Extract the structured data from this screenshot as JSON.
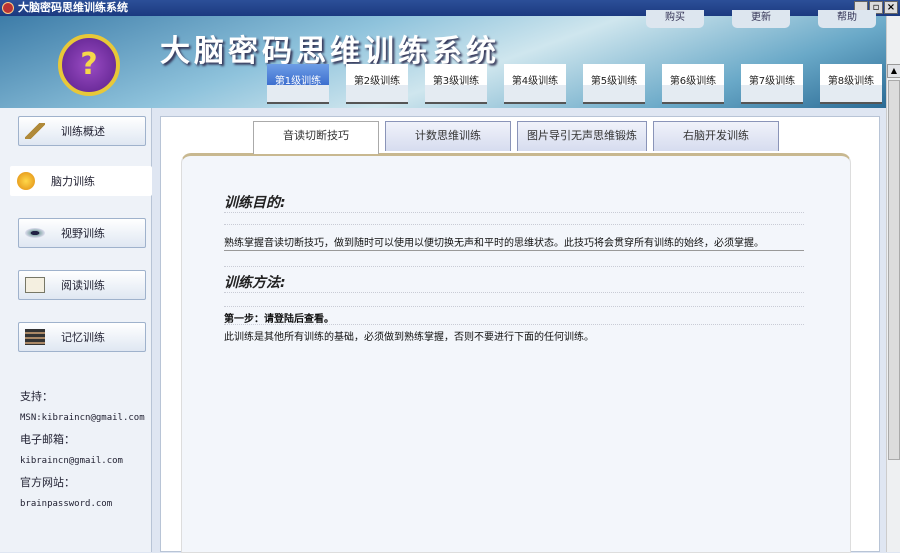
{
  "window": {
    "title": "大脑密码思维训练系统"
  },
  "header": {
    "app_title": "大脑密码思维训练系统",
    "logo_glyph": "?",
    "top_links": [
      "购买",
      "更新",
      "帮助"
    ]
  },
  "levels": [
    "第1级训练",
    "第2级训练",
    "第3级训练",
    "第4级训练",
    "第5级训练",
    "第6级训练",
    "第7级训练",
    "第8级训练"
  ],
  "sidebar": {
    "items": [
      {
        "label": "训练概述",
        "icon": "pen-icon"
      },
      {
        "label": "脑力训练",
        "icon": "brain-icon"
      },
      {
        "label": "视野训练",
        "icon": "eye-icon"
      },
      {
        "label": "阅读训练",
        "icon": "book-icon"
      },
      {
        "label": "记忆训练",
        "icon": "books-stack-icon"
      }
    ],
    "support_label": "支持：",
    "msn": "MSN:kibraincn@gmail.com",
    "email_label": "电子邮箱：",
    "email": "kibraincn@gmail.com",
    "site_label": "官方网站：",
    "site": "brainpassword.com"
  },
  "tabs": [
    "音读切断技巧",
    "计数思维训练",
    "图片导引无声思维锻炼",
    "右脑开发训练"
  ],
  "content": {
    "purpose_title": "训练目的:",
    "purpose_text": "熟练掌握音读切断技巧，做到随时可以使用以便切换无声和平时的思维状态。此技巧将会贯穿所有训练的始终，必须掌握。",
    "method_title": "训练方法:",
    "step1": "第一步：请登陆后查看。",
    "note": "此训练是其他所有训练的基础，必须做到熟练掌握，否则不要进行下面的任何训练。"
  }
}
